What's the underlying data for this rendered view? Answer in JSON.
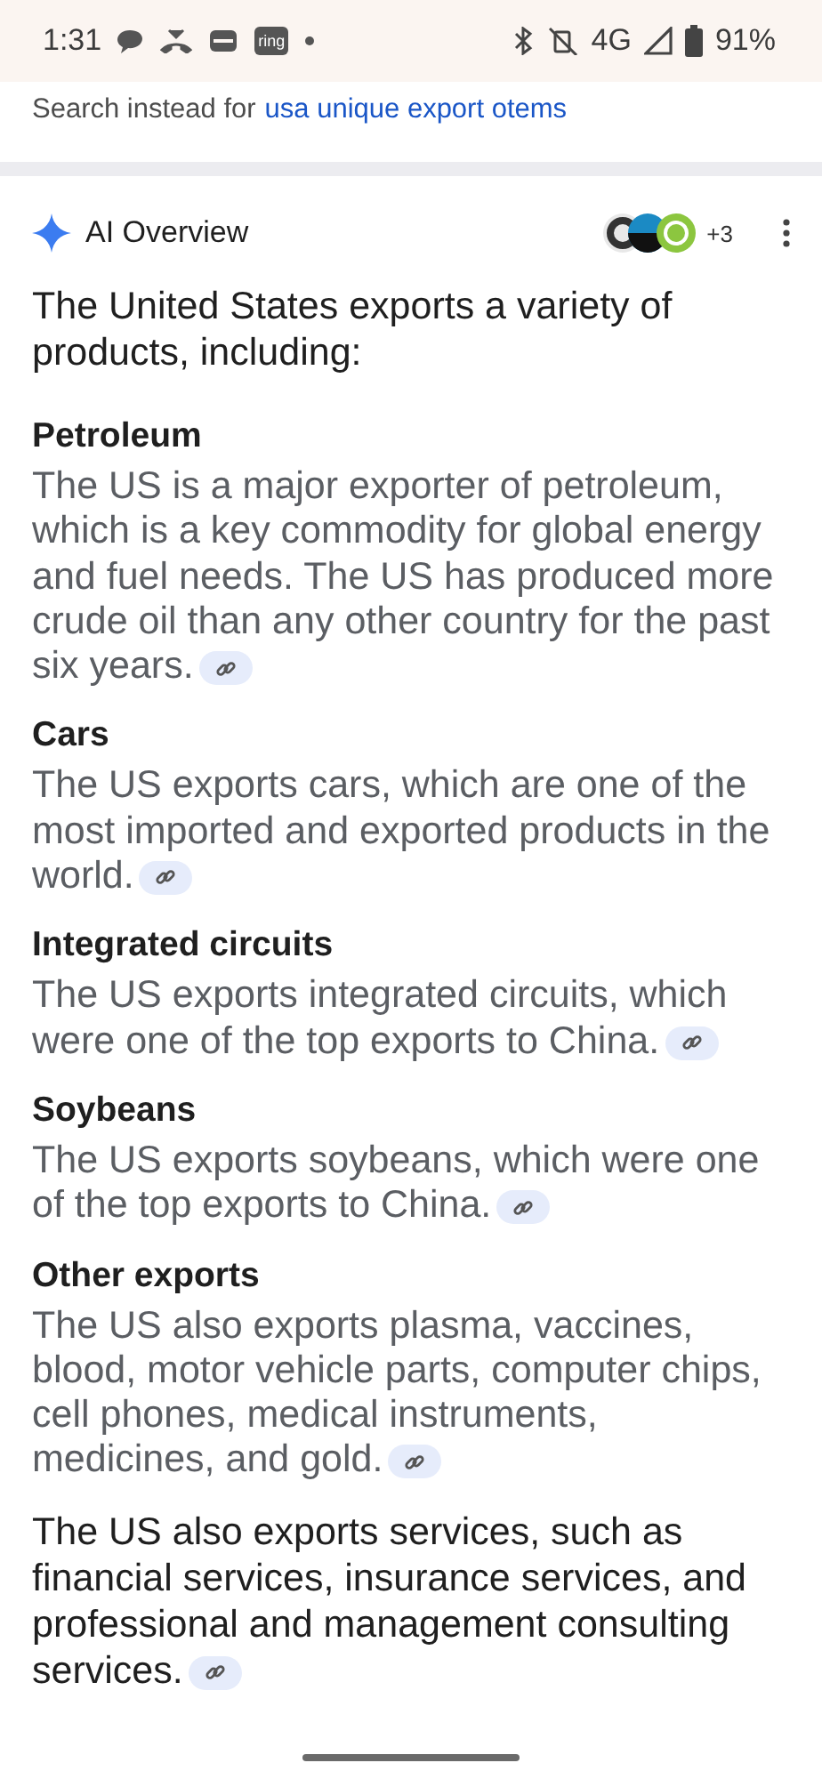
{
  "status_bar": {
    "time": "1:31",
    "app_badge": "ring",
    "network": "4G",
    "battery": "91%"
  },
  "spelling": {
    "prefix": "Search instead for",
    "link": "usa unique export otems"
  },
  "ai_overview": {
    "title": "AI Overview",
    "sources_more": "+3",
    "content": [
      {
        "kind": "paragraph",
        "text": "The United States exports a variety of products, including:",
        "cited": false
      },
      {
        "kind": "section",
        "heading": "Petroleum",
        "text": "The US is a major exporter of petroleum, which is a key commodity for global energy and fuel needs. The US has produced more crude oil than any other country for the past six years.",
        "cited": true
      },
      {
        "kind": "section",
        "heading": "Cars",
        "text": "The US exports cars, which are one of the most imported and exported products in the world.",
        "cited": true
      },
      {
        "kind": "section",
        "heading": "Integrated circuits",
        "text": "The US exports integrated circuits, which were one of the top exports to China.",
        "cited": true
      },
      {
        "kind": "section",
        "heading": "Soybeans",
        "text": "The US exports soybeans, which were one of the top exports to China.",
        "cited": true
      },
      {
        "kind": "section",
        "heading": "Other exports",
        "text": "The US also exports plasma, vaccines, blood, motor vehicle parts, computer chips, cell phones, medical instruments, medicines, and gold.",
        "cited": true
      },
      {
        "kind": "paragraph",
        "text": "The US also exports services, such as financial services, insurance services, and professional and management consulting services.",
        "cited": true
      }
    ]
  }
}
